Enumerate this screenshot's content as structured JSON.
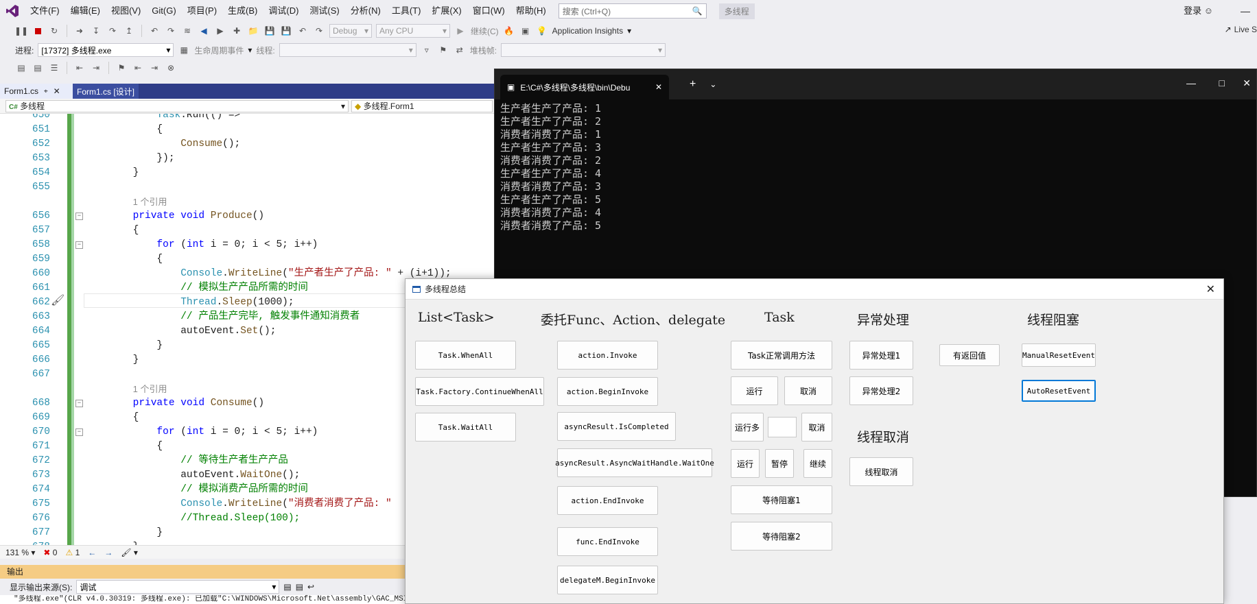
{
  "menubar": {
    "logo": "VS",
    "items": [
      "文件(F)",
      "编辑(E)",
      "视图(V)",
      "Git(G)",
      "项目(P)",
      "生成(B)",
      "调试(D)",
      "测试(S)",
      "分析(N)",
      "工具(T)",
      "扩展(X)",
      "窗口(W)",
      "帮助(H)"
    ],
    "search_placeholder": "搜索 (Ctrl+Q)",
    "solution_name": "多线程",
    "login": "登录"
  },
  "toolbar1": {
    "config": "Debug",
    "platform": "Any CPU",
    "continue": "继续(C)",
    "insights": "Application Insights",
    "live_share": "Live S"
  },
  "toolbar2": {
    "process_label": "进程:",
    "process_value": "[17372] 多线程.exe",
    "lifecycle_label": "生命周期事件",
    "thread_label": "线程:",
    "stackframe_label": "堆栈帧:"
  },
  "doc_tabs": {
    "tab1": "Form1.cs",
    "tab2": "Form1.cs [设计]"
  },
  "navbar": {
    "project": "多线程",
    "class": "多线程.Form1"
  },
  "code_lines": [
    {
      "n": "650",
      "html": "            <span class=\"ty\">Task</span>.Run(() =>"
    },
    {
      "n": "651",
      "html": "            {"
    },
    {
      "n": "652",
      "html": "                <span class=\"mt\">Consume</span>();"
    },
    {
      "n": "653",
      "html": "            });"
    },
    {
      "n": "654",
      "html": "        }"
    },
    {
      "n": "655",
      "html": ""
    },
    {
      "n": "",
      "html": "        <span class=\"ref\">1 个引用</span>"
    },
    {
      "n": "656",
      "html": "        <span class=\"kw\">private void</span> <span class=\"mt\">Produce</span>()"
    },
    {
      "n": "657",
      "html": "        {"
    },
    {
      "n": "658",
      "html": "            <span class=\"kw\">for</span> (<span class=\"kw\">int</span> i = 0; i &lt; 5; i++)"
    },
    {
      "n": "659",
      "html": "            {"
    },
    {
      "n": "660",
      "html": "                <span class=\"ty\">Console</span>.<span class=\"mt\">WriteLine</span>(<span class=\"str\">\"生产者生产了产品: \"</span> + (i+1));"
    },
    {
      "n": "661",
      "html": "                <span class=\"cm\">// 模拟生产产品所需的时间</span>"
    },
    {
      "n": "662",
      "html": "                <span class=\"ty\">Thread</span>.<span class=\"mt\">Sleep</span>(1000);"
    },
    {
      "n": "663",
      "html": "                <span class=\"cm\">// 产品生产完毕, 触发事件通知消费者</span>"
    },
    {
      "n": "664",
      "html": "                autoEvent.<span class=\"mt\">Set</span>();"
    },
    {
      "n": "665",
      "html": "            }"
    },
    {
      "n": "666",
      "html": "        }"
    },
    {
      "n": "667",
      "html": ""
    },
    {
      "n": "",
      "html": "        <span class=\"ref\">1 个引用</span>"
    },
    {
      "n": "668",
      "html": "        <span class=\"kw\">private void</span> <span class=\"mt\">Consume</span>()"
    },
    {
      "n": "669",
      "html": "        {"
    },
    {
      "n": "670",
      "html": "            <span class=\"kw\">for</span> (<span class=\"kw\">int</span> i = 0; i &lt; 5; i++)"
    },
    {
      "n": "671",
      "html": "            {"
    },
    {
      "n": "672",
      "html": "                <span class=\"cm\">// 等待生产者生产产品</span>"
    },
    {
      "n": "673",
      "html": "                autoEvent.<span class=\"mt\">WaitOne</span>();"
    },
    {
      "n": "674",
      "html": "                <span class=\"cm\">// 模拟消费产品所需的时间</span>"
    },
    {
      "n": "675",
      "html": "                <span class=\"ty\">Console</span>.<span class=\"mt\">WriteLine</span>(<span class=\"str\">\"消费者消费了产品: \"</span>"
    },
    {
      "n": "676",
      "html": "                <span class=\"cm\">//Thread.Sleep(100);</span>"
    },
    {
      "n": "677",
      "html": "            }"
    },
    {
      "n": "678",
      "html": "        }"
    }
  ],
  "zoombar": {
    "zoom": "131 %",
    "errors": "0",
    "warnings": "1"
  },
  "output": {
    "title": "输出",
    "source_label": "显示输出来源(S):",
    "source_value": "调试",
    "text": "\"多线程.exe\"(CLR v4.0.30319: 多线程.exe): 已加载\"C:\\WINDOWS\\Microsoft.Net\\assembly\\GAC_MSIL\\"
  },
  "console": {
    "tab_title": "E:\\C#\\多线程\\多线程\\bin\\Debu",
    "lines": [
      "生产者生产了产品: 1",
      "生产者生产了产品: 2",
      "消费者消费了产品: 1",
      "生产者生产了产品: 3",
      "消费者消费了产品: 2",
      "生产者生产了产品: 4",
      "消费者消费了产品: 3",
      "生产者生产了产品: 5",
      "消费者消费了产品: 4",
      "消费者消费了产品: 5"
    ]
  },
  "winform": {
    "title": "多线程总结",
    "headings": {
      "list_task": "List<Task>",
      "delegate": "委托Func、Action、delegate",
      "task": "Task",
      "exception": "异常处理",
      "blocking": "线程阻塞",
      "cancel": "线程取消"
    },
    "buttons": {
      "task_whenall": "Task.WhenAll",
      "task_factory_continue": "Task.Factory.ContinueWhenAll",
      "task_waitall": "Task.WaitAll",
      "action_invoke": "action.Invoke",
      "action_begininvoke": "action.BeginInvoke",
      "asyncresult_iscompleted": "asyncResult.IsCompleted",
      "asyncresult_waitone": "asyncResult.AsyncWaitHandle.WaitOne",
      "action_endinvoke": "action.EndInvoke",
      "func_endinvoke": "func.EndInvoke",
      "delegatem_begininvoke": "delegateM.BeginInvoke",
      "task_normal": "Task正常调用方法",
      "run1": "运行",
      "cancel1": "取消",
      "run_multi": "运行多",
      "cancel2": "取消",
      "run2": "运行",
      "pause": "暂停",
      "resume": "继续",
      "wait_block1": "等待阻塞1",
      "wait_block2": "等待阻塞2",
      "exception1": "异常处理1",
      "exception2": "异常处理2",
      "with_return": "有返回值",
      "thread_cancel": "线程取消",
      "manual_reset": "ManualResetEvent",
      "auto_reset": "AutoResetEvent"
    }
  }
}
